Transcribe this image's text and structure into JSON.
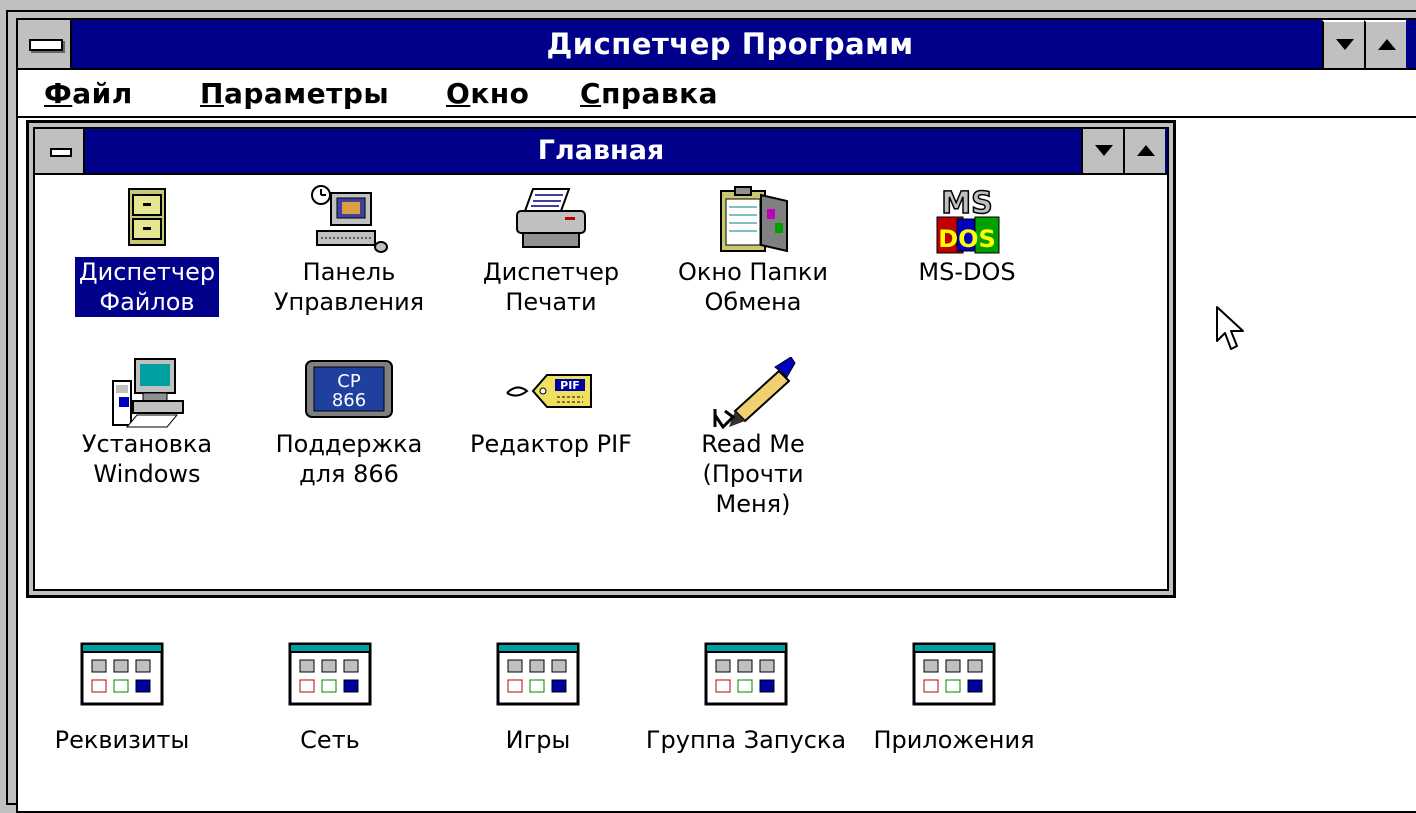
{
  "window": {
    "title": "Диспетчер Программ"
  },
  "menu": {
    "items": [
      {
        "accel": "Ф",
        "rest": "айл"
      },
      {
        "accel": "П",
        "rest": "араметры"
      },
      {
        "accel": "О",
        "rest": "кно"
      },
      {
        "accel": "С",
        "rest": "правка"
      }
    ]
  },
  "group_window": {
    "title": "Главная",
    "icons": [
      {
        "line1": "Диспетчер",
        "line2": "Файлов",
        "line3": "",
        "icon": "file-cabinet-icon",
        "selected": true
      },
      {
        "line1": "Панель",
        "line2": "Управления",
        "line3": "",
        "icon": "control-panel-icon"
      },
      {
        "line1": "Диспетчер",
        "line2": "Печати",
        "line3": "",
        "icon": "printer-icon"
      },
      {
        "line1": "Окно Папки",
        "line2": "Обмена",
        "line3": "",
        "icon": "clipboard-icon"
      },
      {
        "line1": "MS-DOS",
        "line2": "",
        "line3": "",
        "icon": "ms-dos-icon"
      },
      {
        "line1": "Установка",
        "line2": "Windows",
        "line3": "",
        "icon": "windows-setup-icon"
      },
      {
        "line1": "Поддержка",
        "line2": "для 866",
        "line3": "",
        "icon": "cp866-icon"
      },
      {
        "line1": "Редактор PIF",
        "line2": "",
        "line3": "",
        "icon": "pif-tag-icon"
      },
      {
        "line1": "Read Me",
        "line2": "(Прочти",
        "line3": "Меня)",
        "icon": "pen-icon"
      }
    ],
    "cp866_text": {
      "top": "CP",
      "bottom": "866"
    },
    "pif_text": "PIF",
    "msdos_text": {
      "top": "MS",
      "bottom": "DOS"
    }
  },
  "minimized_groups": [
    {
      "label": "Реквизиты"
    },
    {
      "label": "Сеть"
    },
    {
      "label": "Игры"
    },
    {
      "label": "Группа Запуска"
    },
    {
      "label": "Приложения"
    }
  ],
  "colors": {
    "titlebar": "#00008b",
    "selection": "#00008b",
    "window_bg": "#ffffff",
    "frame": "#c0c0c0"
  }
}
